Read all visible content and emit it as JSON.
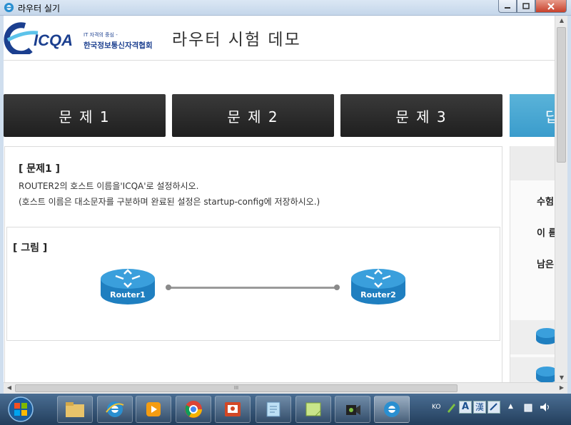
{
  "window": {
    "title": "라우터 실기"
  },
  "header": {
    "logo_text": "ICQA",
    "logo_tagline": "IT 자격의 중심 -",
    "logo_org": "한국정보통신자격협회",
    "page_title": "라우터 시험 데모"
  },
  "tabs": [
    {
      "label": "문 제 1"
    },
    {
      "label": "문 제 2"
    },
    {
      "label": "문 제 3"
    },
    {
      "label": "답"
    }
  ],
  "question": {
    "heading": "[ 문제1 ]",
    "line1": "ROUTER2의 호스트 이름을'ICQA'로 설정하시오.",
    "line2": "(호스트 이름은 대소문자를 구분하며 완료된 설정은 startup-config에 저장하시오.)"
  },
  "figure": {
    "heading": "[ 그림 ]",
    "router1": "Router1",
    "router2": "Router2"
  },
  "side": {
    "label1": "수험",
    "label2": "이 름",
    "label3": "남은"
  },
  "scroll": {
    "grip": "III"
  },
  "tray": {
    "lang": "KO",
    "ime_a": "A",
    "ime_han": "漢"
  },
  "colors": {
    "accent_blue": "#4aa8d4",
    "tab_dark": "#2a2a2a",
    "router_blue": "#1f7fc0"
  }
}
